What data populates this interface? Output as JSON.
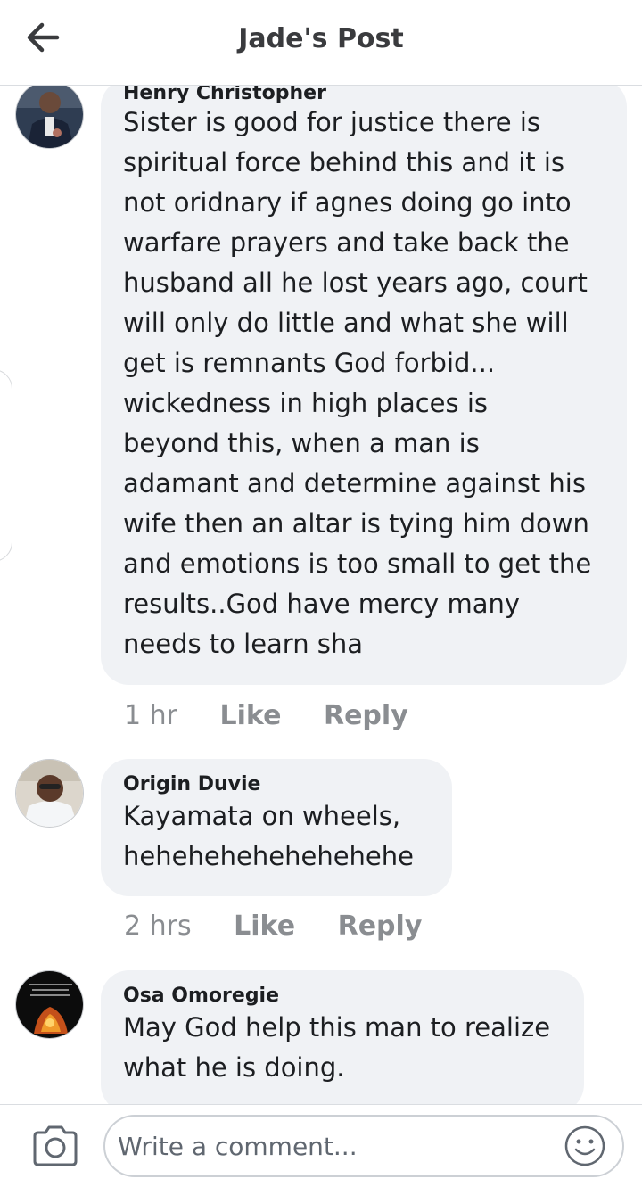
{
  "header": {
    "title": "Jade's Post",
    "back_icon": "arrow-left-icon"
  },
  "comments": [
    {
      "author": "Henry Christopher",
      "lines": [
        "Sister is good for justice there is",
        "spiritual force behind this and it is",
        "not oridnary if agnes doing go into",
        "warfare prayers and take back the",
        "husband all he lost years ago, court",
        "will only do little and what she will",
        "get is remnants God forbid...",
        "wickedness in high places is",
        "beyond this, when a man is",
        "adamant and determine against his",
        "wife then an altar is tying him down",
        "and emotions is too small to get the",
        "results..God have mercy many",
        "needs to learn sha"
      ],
      "time": "1 hr",
      "like_label": "Like",
      "reply_label": "Reply"
    },
    {
      "author": "Origin Duvie",
      "lines": [
        "Kayamata on wheels,",
        "hehehehehehehehehe"
      ],
      "time": "2 hrs",
      "like_label": "Like",
      "reply_label": "Reply"
    },
    {
      "author": "Osa Omoregie",
      "lines": [
        "May God help this man to realize",
        "what he is doing."
      ]
    }
  ],
  "footer": {
    "comment_placeholder": "Write a comment...",
    "camera_icon": "camera-icon",
    "emoji_icon": "smiley-icon"
  },
  "colors": {
    "bubble_bg": "#f0f2f5",
    "meta_text": "#8a8d91",
    "title_text": "#3a3b3e",
    "divider": "#dadde1"
  }
}
